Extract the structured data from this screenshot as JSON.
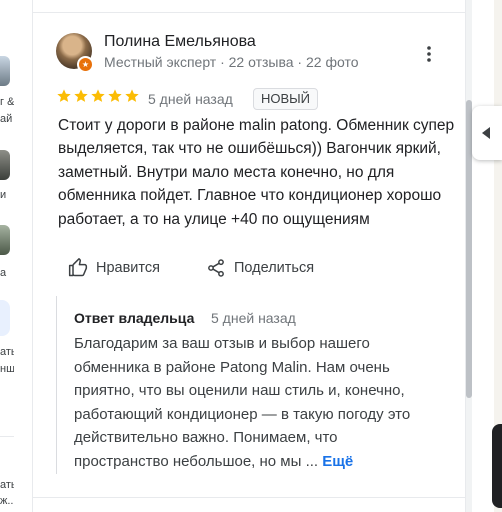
{
  "left_panel": {
    "fragments": [
      "г &",
      "ай",
      "и",
      "а",
      "ать",
      "нше",
      "ать",
      "ж..."
    ]
  },
  "review": {
    "author": "Полина Емельянова",
    "meta": "Местный эксперт · 22 отзыва · 22 фото",
    "rating": 5,
    "date": "5 дней назад",
    "badge": "НОВЫЙ",
    "text": "Стоит у дороги в районе malin patong. Обменник супер выделяется, так что не ошибёшься)) Вагончик яркий, заметный. Внутри мало места конечно, но для обменника пойдет. Главное что кондиционер хорошо работает, а то на улице +40 по ощущениям",
    "like_label": "Нравится",
    "share_label": "Поделиться"
  },
  "owner_reply": {
    "title": "Ответ владельца",
    "date": "5 дней назад",
    "text": "Благодарим за ваш отзыв и выбор нашего обменника в районе  Patong Malin. Нам очень приятно, что вы оценили наш стиль и, конечно, работающий кондиционер — в такую погоду это действительно важно. Понимаем, что пространство небольшое, но мы ...",
    "more_label": "Ещё"
  },
  "colors": {
    "star": "#fbbc04",
    "link": "#1a73e8",
    "badge_orange": "#e8710a"
  },
  "icons": {
    "more": "more-vert-icon",
    "like": "thumb-up-icon",
    "share": "share-icon",
    "collapse": "chevron-left-icon"
  }
}
